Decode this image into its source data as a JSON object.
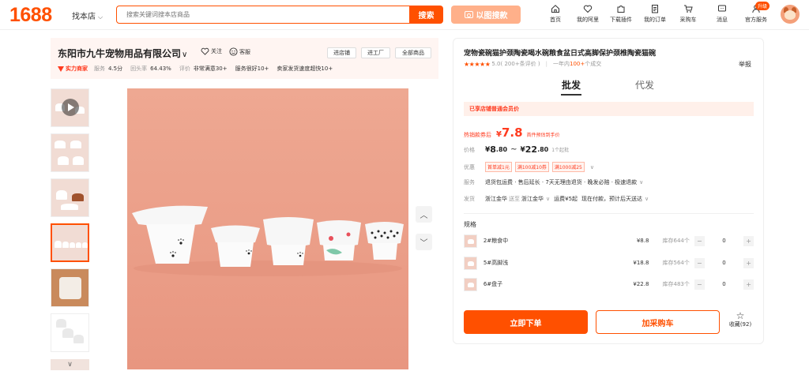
{
  "header": {
    "logo": "1688",
    "find_shop": "找本店",
    "search_placeholder": "搜索关键词搜本店商品",
    "search_button": "搜索",
    "image_search_button": "以图搜款",
    "nav": [
      {
        "label": "首页",
        "icon": "home-icon"
      },
      {
        "label": "我的阿里",
        "icon": "heart-icon"
      },
      {
        "label": "下载插件",
        "icon": "puzzle-icon"
      },
      {
        "label": "我的订单",
        "icon": "order-icon"
      },
      {
        "label": "采购车",
        "icon": "cart-icon"
      },
      {
        "label": "消息",
        "icon": "message-icon"
      },
      {
        "label": "官方服务",
        "icon": "service-icon"
      }
    ],
    "service_badge": "升级"
  },
  "shop": {
    "name": "东阳市九牛宠物用品有限公司",
    "follow": "关注",
    "customer_service": "客服",
    "buttons": [
      "进店铺",
      "进工厂",
      "全部商品"
    ],
    "power_tag": "实力商家",
    "metrics": [
      {
        "key": "服务",
        "value": "4.5分"
      },
      {
        "key": "回头率",
        "value": "64.43%"
      },
      {
        "key": "评价",
        "value": ""
      }
    ],
    "review_tags": [
      "非常满意30+",
      "服务很好10+",
      "卖家发货速度超快10+"
    ]
  },
  "product": {
    "title": "宠物瓷碗猫护颈陶瓷喝水碗粮食盆日式高脚保护颈椎陶瓷猫碗",
    "rating_score": "5.0",
    "rating_count": "( 200+条评价 )",
    "sales_prefix": "一年内",
    "sales_count": "100+",
    "sales_suffix": "个成交",
    "report": "举报",
    "tabs": [
      "批发",
      "代发"
    ],
    "member_notice": "已享店铺普通会员价",
    "promo": {
      "label": "热销款券后",
      "currency": "¥",
      "price": "7.8",
      "note": "首件预估到手价"
    },
    "price": {
      "label": "价格",
      "currency": "¥",
      "low_int": "8",
      "low_dec": ".80",
      "high_int": "22",
      "high_dec": ".80",
      "min_order": "1个起批"
    },
    "coupons": {
      "label": "优惠",
      "items": [
        "首单减1元",
        "满100减10券",
        "满1000减25"
      ]
    },
    "service": {
      "label": "服务",
      "text": "退货包运费 · 售后延长 · 7天无理由退货 · 晚发必赔 · 极速退款"
    },
    "shipping": {
      "label": "发货",
      "from": "浙江金华",
      "to_word": "送至",
      "to": "浙江金华",
      "fee": "运费¥5起",
      "eta": "现在付款，预计后天送达"
    },
    "spec_label": "规格",
    "specs": [
      {
        "name": "2#粮食中",
        "price": "¥8.8",
        "stock": "库存644个",
        "qty": "0"
      },
      {
        "name": "5#高脚浅",
        "price": "¥18.8",
        "stock": "库存564个",
        "qty": "0"
      },
      {
        "name": "6#盘子",
        "price": "¥22.8",
        "stock": "库存483个",
        "qty": "0"
      }
    ],
    "order_button": "立即下单",
    "cart_button": "加采购车",
    "collect_label": "收藏",
    "collect_count": "(92)"
  },
  "colors": {
    "accent": "#ff5000",
    "sale_red": "#ff3b1f",
    "image_bg": "#eda18d"
  }
}
